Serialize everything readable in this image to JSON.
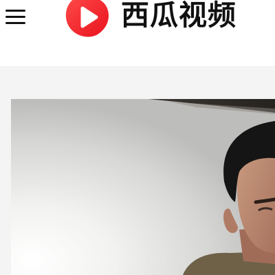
{
  "app": {
    "brand_name": "西瓜视频"
  },
  "header": {
    "menu_icon": "hamburger-menu-icon",
    "logo_icon": "xigua-play-logo-icon"
  },
  "colors": {
    "brand_red": "#f4272f",
    "page_bg": "#f4f4f4",
    "header_bg": "#ffffff",
    "text_primary": "#111111"
  },
  "feed": {
    "video_card": {
      "thumbnail": "man-in-room-thumbnail"
    }
  }
}
